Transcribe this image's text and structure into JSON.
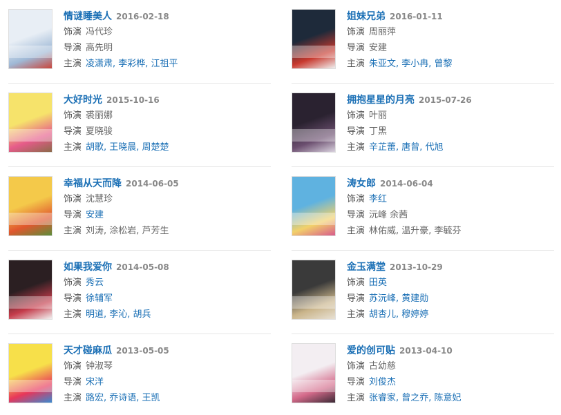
{
  "labels": {
    "role": "饰演",
    "director": "导演",
    "cast": "主演"
  },
  "shows": [
    {
      "title": "情谜睡美人",
      "date": "2016-02-18",
      "role": "冯代珍",
      "role_link": false,
      "director": "高先明",
      "director_link": false,
      "cast": "凌潇肃, 李彩桦, 江祖平",
      "cast_link": true,
      "poster_colors": [
        "#e8eef5",
        "#9fb9d6",
        "#c9463c"
      ]
    },
    {
      "title": "姐妹兄弟",
      "date": "2016-01-11",
      "role": "周丽萍",
      "role_link": false,
      "director": "安建",
      "director_link": false,
      "cast": "朱亚文, 李小冉, 曾黎",
      "cast_link": true,
      "poster_colors": [
        "#1e2a3a",
        "#c8392e",
        "#f0f0f0"
      ]
    },
    {
      "title": "大好时光",
      "date": "2015-10-16",
      "role": "裘丽娜",
      "role_link": false,
      "director": "夏晓骏",
      "director_link": false,
      "cast": "胡歌, 王晓晨, 周楚楚",
      "cast_link": true,
      "poster_colors": [
        "#f6e36b",
        "#e65b8a",
        "#8c6a4a"
      ]
    },
    {
      "title": "拥抱星星的月亮",
      "date": "2015-07-26",
      "role": "叶丽",
      "role_link": false,
      "director": "丁黑",
      "director_link": false,
      "cast": "辛芷蕾, 唐曾, 代旭",
      "cast_link": true,
      "poster_colors": [
        "#2a2230",
        "#6b4e6f",
        "#d9d2de"
      ]
    },
    {
      "title": "幸福从天而降",
      "date": "2014-06-05",
      "role": "沈慧珍",
      "role_link": false,
      "director": "安建",
      "director_link": true,
      "cast": "刘涛, 涂松岩, 芦芳生",
      "cast_link": false,
      "poster_colors": [
        "#f4c94a",
        "#e0572e",
        "#5b8e3a"
      ]
    },
    {
      "title": "涛女郎",
      "date": "2014-06-04",
      "role": "李红",
      "role_link": true,
      "director": "沅峰 余茜",
      "director_link": false,
      "cast": "林佑威, 温升豪, 李毓芬",
      "cast_link": false,
      "poster_colors": [
        "#5fb2e0",
        "#f2d16a",
        "#d85b8c"
      ]
    },
    {
      "title": "如果我爱你",
      "date": "2014-05-08",
      "role": "秀云",
      "role_link": true,
      "director": "徐辅军",
      "director_link": true,
      "cast": "明道, 李沁, 胡兵",
      "cast_link": true,
      "poster_colors": [
        "#2b1f22",
        "#c43b4a",
        "#f2f2f2"
      ]
    },
    {
      "title": "金玉满堂",
      "date": "2013-10-29",
      "role": "田英",
      "role_link": true,
      "director": "苏沅峰, 黄建勋",
      "director_link": true,
      "cast": "胡杏儿, 穆婷婷",
      "cast_link": true,
      "poster_colors": [
        "#3a3a3a",
        "#c9b48a",
        "#e8e1d4"
      ]
    },
    {
      "title": "天才碰麻瓜",
      "date": "2013-05-05",
      "role": "钟淑琴",
      "role_link": false,
      "director": "宋洋",
      "director_link": true,
      "cast": "路宏, 乔诗语, 王凯",
      "cast_link": true,
      "poster_colors": [
        "#f7e04a",
        "#e8365a",
        "#3a8ad0"
      ]
    },
    {
      "title": "爱的创可贴",
      "date": "2013-04-10",
      "role": "古幼慈",
      "role_link": false,
      "director": "刘俊杰",
      "director_link": true,
      "cast": "张睿家, 曾之乔, 陈意妃",
      "cast_link": true,
      "poster_colors": [
        "#f3eef2",
        "#d46a8a",
        "#3b2a36"
      ]
    }
  ]
}
